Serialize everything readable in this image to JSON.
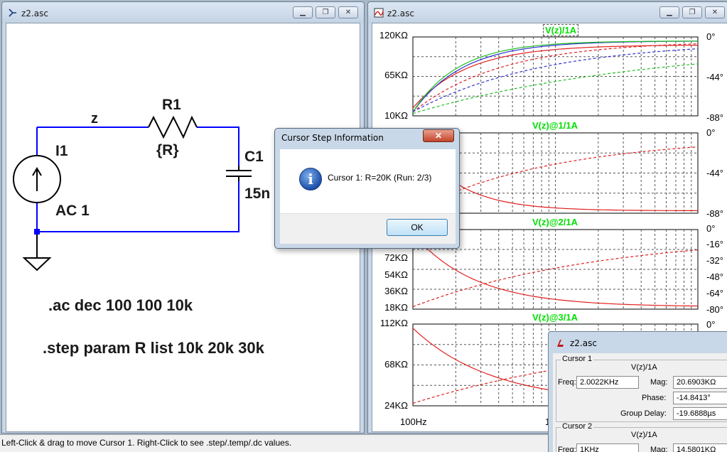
{
  "schematic_window": {
    "title": "z2.asc",
    "net_label": "z",
    "resistor_name": "R1",
    "resistor_value": "{R}",
    "capacitor_name": "C1",
    "capacitor_value": "15n",
    "source_name": "I1",
    "source_value": "AC 1",
    "directive_ac": ".ac dec 100 100 10k",
    "directive_step": ".step param  R list 10k 20k 30k"
  },
  "plot_window": {
    "title": "z2.asc",
    "panes": [
      {
        "title": "V(z)/1A",
        "left_labels": [
          "120KΩ",
          "65KΩ",
          "10KΩ"
        ],
        "right_labels": [
          "0°",
          "-44°",
          "-88°"
        ]
      },
      {
        "title": "V(z)@1/1A",
        "left_labels": [],
        "right_labels": [
          "0°",
          "-44°",
          "-88°"
        ]
      },
      {
        "title": "V(z)@2/1A",
        "left_labels": [
          "72KΩ",
          "54KΩ",
          "36KΩ",
          "18KΩ"
        ],
        "right_labels": [
          "0°",
          "-16°",
          "-32°",
          "-48°",
          "-64°",
          "-80°"
        ]
      },
      {
        "title": "V(z)@3/1A",
        "left_labels": [
          "112KΩ",
          "68KΩ",
          "24KΩ"
        ],
        "right_labels": [
          "0°"
        ]
      }
    ],
    "x_label_first": "100Hz",
    "x_label_partial": "1"
  },
  "dialog": {
    "title": "Cursor Step Information",
    "close_label": "✕",
    "message": "Cursor 1: R=20K  (Run: 2/3)",
    "ok_label": "OK"
  },
  "cursor_window": {
    "title": "z2.asc",
    "cursor1": {
      "group_label": "Cursor 1",
      "trace": "V(z)/1A",
      "freq_label": "Freq:",
      "freq_value": "2.0022KHz",
      "mag_label": "Mag:",
      "mag_value": "20.6903KΩ",
      "phase_label": "Phase:",
      "phase_value": "-14.8413°",
      "gd_label": "Group Delay:",
      "gd_value": "-19.6888µs"
    },
    "cursor2": {
      "group_label": "Cursor 2",
      "trace": "V(z)/1A",
      "freq_label": "Freq:",
      "freq_value": "1KHz",
      "mag_label": "Mag:",
      "mag_value": "14.5801KΩ"
    }
  },
  "status_bar": {
    "text": "Left-Click & drag to move Cursor 1.  Right-Click to see .step/.temp/.dc values."
  },
  "colors": {
    "trace_run1": "#e02020",
    "trace_run2": "#3030d0",
    "trace_run3": "#20c020",
    "grid": "#c0c0c0",
    "pane_title": "#00e000",
    "selection_blue": "#0000ff"
  }
}
